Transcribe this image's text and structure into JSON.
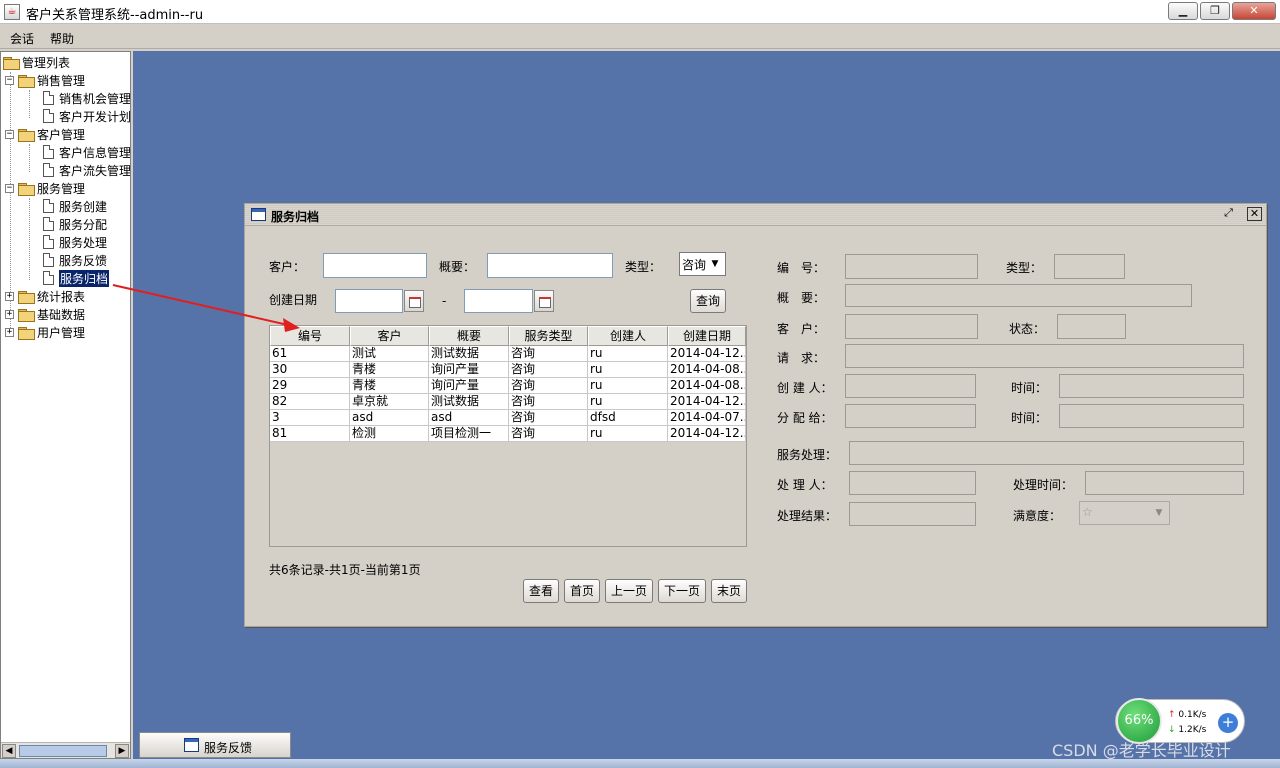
{
  "window": {
    "title": "客户关系管理系统--admin--ru",
    "controls": [
      "▁",
      "❐",
      "✕"
    ]
  },
  "menu": {
    "items": [
      "会话",
      "帮助"
    ]
  },
  "tree": {
    "root": "管理列表",
    "groups": [
      {
        "label": "销售管理",
        "children": [
          "销售机会管理",
          "客户开发计划"
        ]
      },
      {
        "label": "客户管理",
        "children": [
          "客户信息管理",
          "客户流失管理"
        ]
      },
      {
        "label": "服务管理",
        "children": [
          "服务创建",
          "服务分配",
          "服务处理",
          "服务反馈",
          "服务归档"
        ]
      },
      {
        "label": "统计报表",
        "children": []
      },
      {
        "label": "基础数据",
        "children": []
      },
      {
        "label": "用户管理",
        "children": []
      }
    ],
    "selected": "服务归档"
  },
  "frame": {
    "title": "服务归档",
    "search": {
      "customer_label": "客户：",
      "summary_label": "概要：",
      "type_label": "类型：",
      "type_value": "咨询",
      "created_date_label": "创建日期",
      "date_separator": "-",
      "query_button": "查询"
    },
    "table": {
      "columns": [
        "编号",
        "客户",
        "概要",
        "服务类型",
        "创建人",
        "创建日期"
      ],
      "rows": [
        [
          "61",
          "测试",
          "测试数据",
          "咨询",
          "ru",
          "2014-04-12..."
        ],
        [
          "30",
          "青楼",
          "询问产量",
          "咨询",
          "ru",
          "2014-04-08..."
        ],
        [
          "29",
          "青楼",
          "询问产量",
          "咨询",
          "ru",
          "2014-04-08..."
        ],
        [
          "82",
          "卓京就",
          "测试数据",
          "咨询",
          "ru",
          "2014-04-12..."
        ],
        [
          "3",
          "asd",
          "asd",
          "咨询",
          "dfsd",
          "2014-04-07..."
        ],
        [
          "81",
          "检测",
          "项目检测一",
          "咨询",
          "ru",
          "2014-04-12..."
        ]
      ]
    },
    "pager": {
      "info": "共6条记录-共1页-当前第1页",
      "view": "查看",
      "first": "首页",
      "prev": "上一页",
      "next": "下一页",
      "last": "末页"
    },
    "detail": {
      "id_label": "编　号：",
      "type_label": "类型：",
      "summary_label": "概　要：",
      "customer_label": "客　户：",
      "status_label": "状态：",
      "request_label": "请　求：",
      "creator_label": "创 建 人：",
      "time_label": "时间：",
      "assignee_label": "分 配 给：",
      "time_label2": "时间：",
      "handling_label": "服务处理：",
      "handler_label": "处 理 人：",
      "handle_time_label": "处理时间：",
      "result_label": "处理结果：",
      "satisfaction_label": "满意度：",
      "satisfaction_value": "☆"
    }
  },
  "minimized": {
    "label": "服务反馈"
  },
  "netmon": {
    "percent": "66%",
    "up": "0.1K/s",
    "down": "1.2K/s"
  },
  "watermark": "CSDN @老学长毕业设计",
  "colors": {
    "desktop": "#5673a9",
    "selection": "#0a246a",
    "arrow": "#e02020"
  }
}
